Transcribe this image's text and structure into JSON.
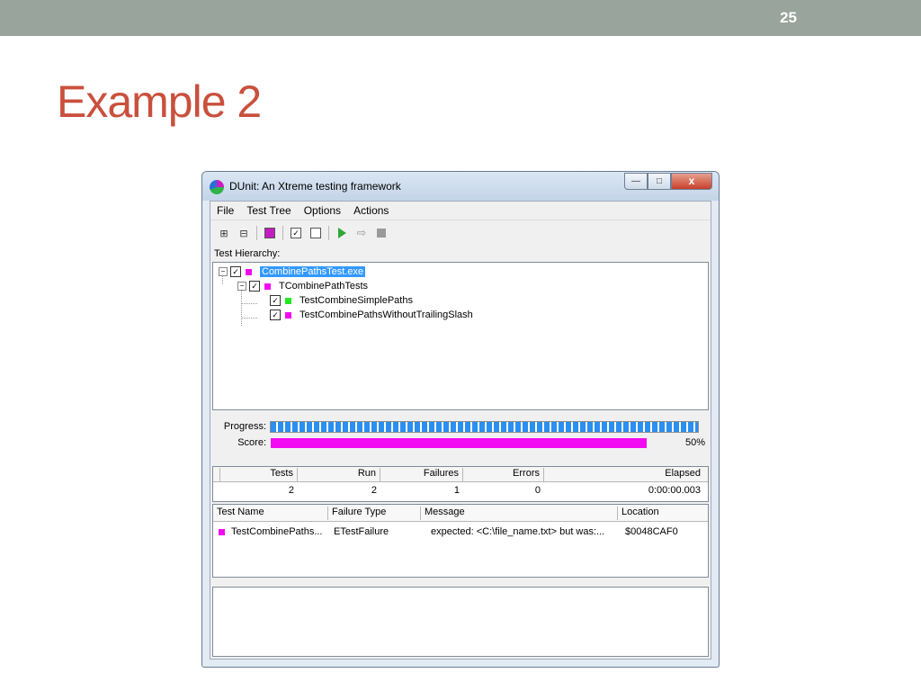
{
  "slide": {
    "number": "25",
    "title": "Example 2"
  },
  "window": {
    "title": "DUnit: An Xtreme testing framework",
    "minimize_label": "—",
    "maximize_label": "□",
    "close_label": "x"
  },
  "menu": [
    "File",
    "Test Tree",
    "Options",
    "Actions"
  ],
  "toolbar": {
    "icons": [
      "tree-expand-icon",
      "tree-collapse-icon",
      "select-failed-icon",
      "check-all-icon",
      "uncheck-all-icon",
      "run-icon",
      "run-selected-icon",
      "stop-icon"
    ]
  },
  "tree": {
    "label": "Test Hierarchy:",
    "nodes": [
      {
        "label": "CombinePathsTest.exe",
        "status_color": "#f00af0"
      },
      {
        "label": "TCombinePathTests",
        "status_color": "#f00af0"
      },
      {
        "label": "TestCombineSimplePaths",
        "status_color": "#22e822"
      },
      {
        "label": "TestCombinePathsWithoutTrailingSlash",
        "status_color": "#f00af0"
      }
    ]
  },
  "progress": {
    "progress_label": "Progress:",
    "progress_fraction": 1.0,
    "score_label": "Score:",
    "score_fraction": 0.5,
    "score_text": "50%"
  },
  "stats": {
    "headers": [
      "Tests",
      "Run",
      "Failures",
      "Errors",
      "Elapsed"
    ],
    "values": [
      "2",
      "2",
      "1",
      "0",
      "0:00:00.003"
    ]
  },
  "failures": {
    "headers": [
      "Test Name",
      "Failure Type",
      "Message",
      "Location"
    ],
    "rows": [
      {
        "test_name": "TestCombinePaths...",
        "failure_type": "ETestFailure",
        "message": "expected: <C:\\file_name.txt> but was:...",
        "location": "$0048CAF0"
      }
    ]
  }
}
